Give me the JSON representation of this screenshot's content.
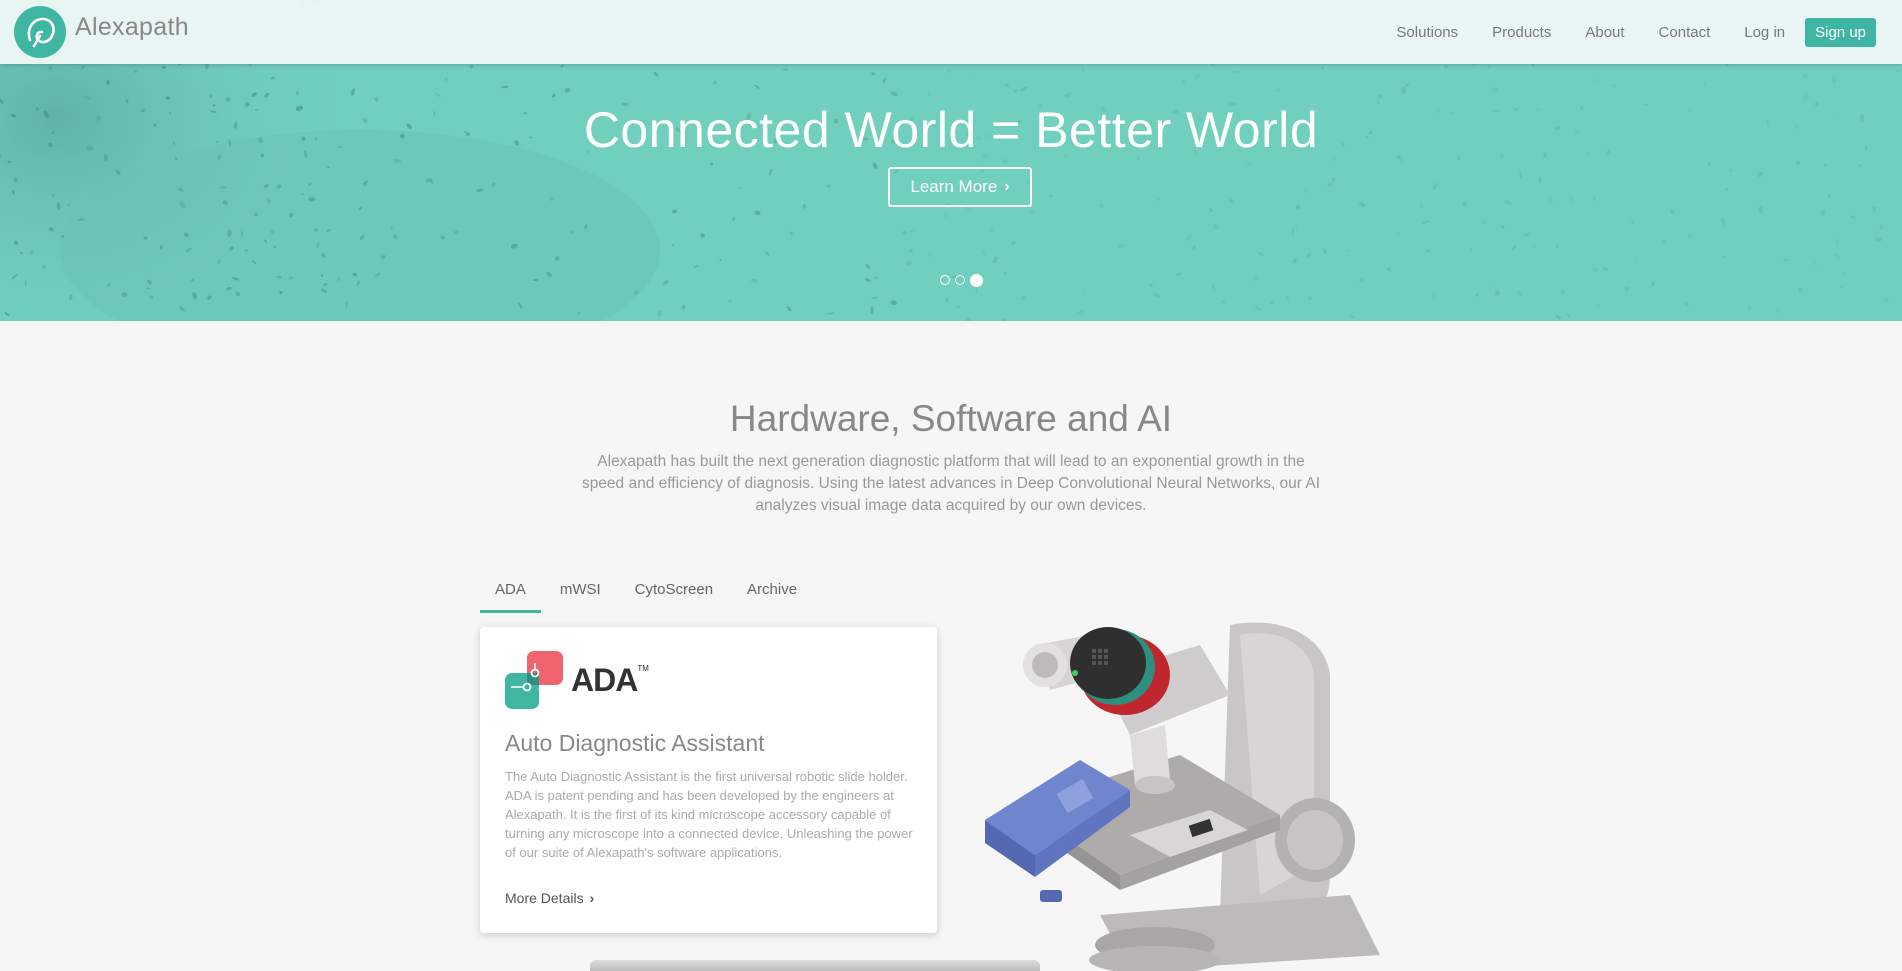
{
  "nav": {
    "brand": "Alexapath",
    "links": [
      "Solutions",
      "Products",
      "About",
      "Contact",
      "Log in"
    ],
    "signup": "Sign up",
    "accent_color": "#3fb6a2"
  },
  "hero": {
    "title": "Connected World = Better World",
    "button_label": "Learn More",
    "button_icon": "chevron-right-icon",
    "slides_total": 3,
    "slide_active": 3,
    "background_color": "#71cfbd"
  },
  "section": {
    "title": "Hardware, Software and AI",
    "description": "Alexapath has built the next generation diagnostic platform that will lead to an exponential growth in the speed and efficiency of diagnosis. Using the latest advances in Deep Convolutional Neural Networks, our AI analyzes visual image data acquired by our own devices."
  },
  "tabs": {
    "items": [
      "ADA",
      "mWSI",
      "CytoScreen",
      "Archive"
    ],
    "active": "ADA"
  },
  "card": {
    "logo_text": "ADA",
    "logo_tm": "TM",
    "title": "Auto Diagnostic Assistant",
    "body": "The Auto Diagnostic Assistant is the first universal robotic slide holder. ADA is patent pending and has been developed by the engineers at Alexapath. It is the first of its kind microscope accessory capable of turning any microscope into a connected device. Unleashing the power of our suite of Alexapath's software applications.",
    "link": "More Details"
  }
}
